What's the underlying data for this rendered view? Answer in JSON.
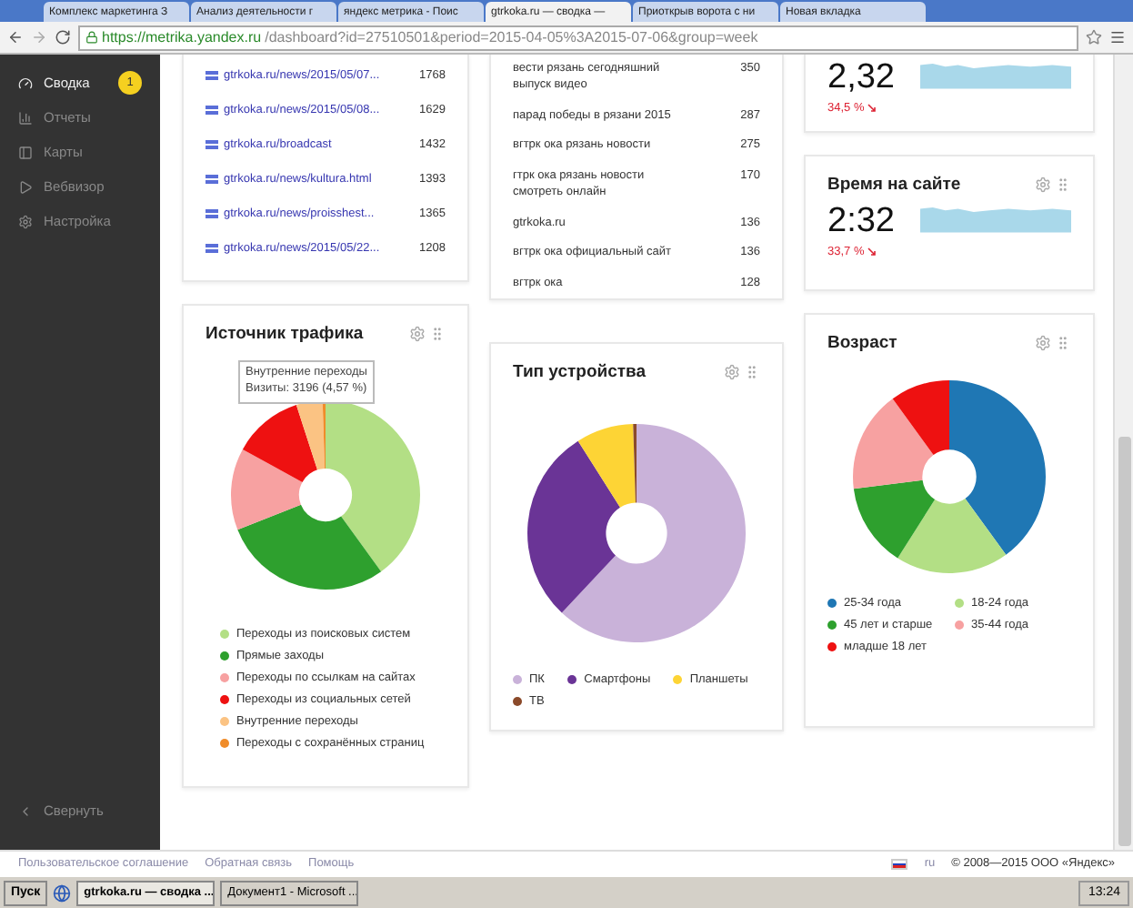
{
  "browser": {
    "tabs": [
      {
        "label": "Комплекс маркетинга З",
        "selected": false
      },
      {
        "label": "Анализ деятельности г",
        "selected": false
      },
      {
        "label": "яндекс метрика - Поис",
        "selected": false
      },
      {
        "label": "gtrkoka.ru — сводка —",
        "selected": true
      },
      {
        "label": "Приоткрыв ворота с ни",
        "selected": false
      },
      {
        "label": "Новая вкладка",
        "selected": false
      }
    ],
    "address_host": "https://metrika.yandex.ru",
    "address_path": "/dashboard?id=27510501&period=2015-04-05%3A2015-07-06&group=week"
  },
  "sidebar": {
    "items": [
      {
        "label": "Сводка",
        "selected": true,
        "badge": "1"
      },
      {
        "label": "Отчеты",
        "selected": false
      },
      {
        "label": "Карты",
        "selected": false
      },
      {
        "label": "Вебвизор",
        "selected": false
      },
      {
        "label": "Настройка",
        "selected": false
      }
    ],
    "collapse": "Свернуть"
  },
  "pages_card": {
    "rows": [
      {
        "link": "gtrkoka.ru/news/2015/05/07...",
        "visits": "1768"
      },
      {
        "link": "gtrkoka.ru/news/2015/05/08...",
        "visits": "1629"
      },
      {
        "link": "gtrkoka.ru/broadcast",
        "visits": "1432"
      },
      {
        "link": "gtrkoka.ru/news/kultura.html",
        "visits": "1393"
      },
      {
        "link": "gtrkoka.ru/news/proisshest...",
        "visits": "1365"
      },
      {
        "link": "gtrkoka.ru/news/2015/05/22...",
        "visits": "1208"
      }
    ]
  },
  "queries_card": {
    "rows": [
      {
        "query": "вести рязань сегодняшний выпуск видео",
        "visits": "350"
      },
      {
        "query": "парад победы в рязани 2015",
        "visits": "287"
      },
      {
        "query": "вгтрк ока рязань новости",
        "visits": "275"
      },
      {
        "query": "гтрк ока рязань новости смотреть онлайн",
        "visits": "170"
      },
      {
        "query": "gtrkoka.ru",
        "visits": "136"
      },
      {
        "query": "вгтрк ока официальный сайт",
        "visits": "136"
      },
      {
        "query": "вгтрк ока",
        "visits": "128"
      }
    ]
  },
  "depth_card": {
    "value": "2,32",
    "change": "34,5 %"
  },
  "time_card": {
    "title": "Время на сайте",
    "value": "2:32",
    "change": "33,7 %"
  },
  "traffic_card": {
    "title": "Источник трафика",
    "tooltip": {
      "title": "Внутренние переходы",
      "text": "Визиты: 3196 (4,57 %)"
    },
    "legend": [
      {
        "label": "Переходы из поисковых систем",
        "color": "#b3df85"
      },
      {
        "label": "Прямые заходы",
        "color": "#2ea02e"
      },
      {
        "label": "Переходы по ссылкам на сайтах",
        "color": "#f7a1a1"
      },
      {
        "label": "Переходы из социальных сетей",
        "color": "#ee1111"
      },
      {
        "label": "Внутренние переходы",
        "color": "#fbc383"
      },
      {
        "label": "Переходы с сохранённых страниц",
        "color": "#f08c2a"
      }
    ]
  },
  "device_card": {
    "title": "Тип устройства",
    "legend": [
      {
        "label": "ПК",
        "color": "#c9b2d9"
      },
      {
        "label": "Смартфоны",
        "color": "#6a3496"
      },
      {
        "label": "Планшеты",
        "color": "#fdd435"
      },
      {
        "label": "ТВ",
        "color": "#8b4a2a"
      }
    ]
  },
  "age_card": {
    "title": "Возраст",
    "legend": [
      {
        "label": "25-34 года",
        "color": "#1f77b4"
      },
      {
        "label": "18-24 года",
        "color": "#b3df85"
      },
      {
        "label": "45 лет и старше",
        "color": "#2ea02e"
      },
      {
        "label": "35-44 года",
        "color": "#f7a1a1"
      },
      {
        "label": "младше 18 лет",
        "color": "#ee1111"
      }
    ]
  },
  "footer": {
    "links": [
      "Пользовательское соглашение",
      "Обратная связь",
      "Помощь"
    ],
    "lang": "ru",
    "copyright": "© 2008—2015 ООО «Яндекс»"
  },
  "taskbar": {
    "start": "Пуск",
    "windows": [
      {
        "label": "gtrkoka.ru — сводка ...",
        "selected": true
      },
      {
        "label": "Документ1 - Microsoft ...",
        "selected": false
      }
    ],
    "clock": "13:24"
  }
}
